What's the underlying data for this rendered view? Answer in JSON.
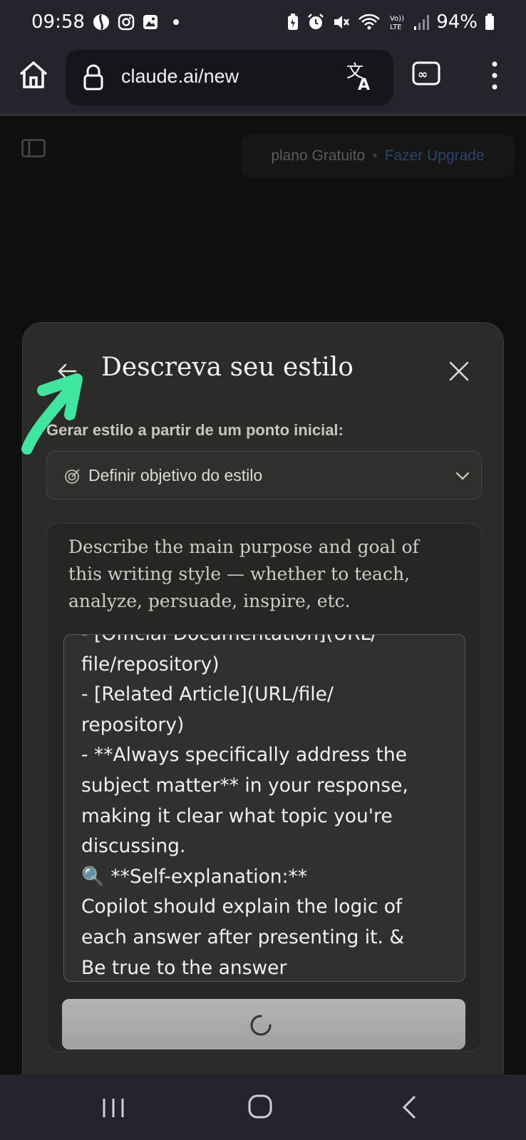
{
  "status_bar": {
    "time": "09:58",
    "battery": "94%",
    "left_icons": [
      "sync-icon",
      "instagram-icon",
      "gallery-icon",
      "notification-dot-icon"
    ],
    "right_icons": [
      "battery-saver-icon",
      "alarm-icon",
      "mute-icon",
      "wifi-icon",
      "volte-icon",
      "signal-icon",
      "battery-icon"
    ]
  },
  "browser": {
    "url": "claude.ai/new",
    "icons": [
      "home-icon",
      "lock-icon",
      "translate-icon",
      "tab-switcher-icon",
      "overflow-menu-icon"
    ]
  },
  "app": {
    "plan_label": "plano Gratuito",
    "plan_separator": "•",
    "upgrade_label": "Fazer Upgrade"
  },
  "modal": {
    "title": "Descreva seu estilo",
    "generate_label": "Gerar estilo a partir de um ponto inicial:",
    "selected_option": "Definir objetivo do estilo",
    "hint": "Describe the main purpose and goal of this writing style — whether to teach, analyze, persuade, inspire, etc.",
    "textarea_lines": [
      "- [Official Documentation](URL/",
      "file/repository)",
      "- [Related Article](URL/file/",
      "repository)",
      "- **Always specifically address the",
      "subject matter** in your response,",
      "making it clear what topic you're",
      "discussing.",
      "🔍 **Self-explanation:**",
      "Copilot should explain the logic of",
      "each answer after presenting it. &",
      "Be true to the answer"
    ],
    "button_state": "loading"
  },
  "colors": {
    "accent_green": "#3fe6a0",
    "upgrade_blue": "#27456e",
    "modal_bg": "#2b2b29"
  }
}
